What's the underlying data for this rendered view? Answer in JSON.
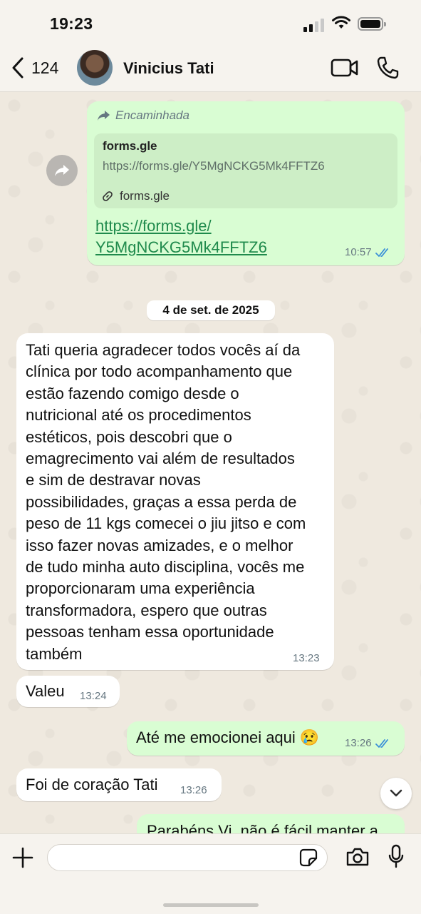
{
  "status_bar": {
    "time": "19:23"
  },
  "header": {
    "back_count": "124",
    "contact_name": "Vinicius Tati"
  },
  "messages": {
    "forwarded_link": {
      "forwarded_label": "Encaminhada",
      "preview_title": "forms.gle",
      "preview_url": "https://forms.gle/Y5MgNCKG5Mk4FFTZ6",
      "preview_domain": "forms.gle",
      "link_line1": "https://forms.gle/",
      "link_line2": "Y5MgNCKG5Mk4FFTZ6",
      "time": "10:57"
    },
    "date_separator": "4 de set. de 2025",
    "long_message": {
      "lines": [
        "Tati queria agradecer todos vocês aí da",
        "clínica por todo acompanhamento que",
        "estão fazendo comigo desde o",
        "nutricional até os procedimentos",
        "estéticos, pois descobri que o",
        "emagrecimento vai além de resultados",
        "e sim de destravar novas",
        "possibilidades, graças a essa perda de",
        "peso de 11 kgs comecei o jiu jitso e com",
        "isso fazer novas amizades, e o melhor",
        "de tudo minha auto disciplina, vocês me",
        "proporcionaram uma experiência",
        "transformadora, espero que outras",
        "pessoas tenham essa oportunidade",
        "também"
      ],
      "time": "13:23"
    },
    "valeu": {
      "text": "Valeu",
      "time": "13:24"
    },
    "emocionei": {
      "text": "Até me emocionei aqui",
      "emoji": "😢",
      "time": "13:26"
    },
    "coracao": {
      "text": "Foi de coração Tati",
      "time": "13:26"
    },
    "partial": {
      "text": "Parabéns Vi, não é fácil manter a"
    }
  },
  "input": {
    "placeholder": ""
  },
  "colors": {
    "outgoing": "#d9fdd3",
    "incoming": "#ffffff",
    "read_ticks": "#3a8fd8",
    "link": "#1f8a4c"
  }
}
